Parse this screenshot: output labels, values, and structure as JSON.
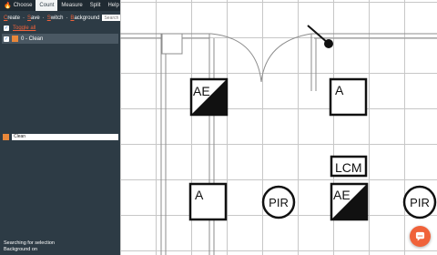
{
  "tabs": [
    {
      "label": "Choose",
      "icon": "flame-icon",
      "active": false
    },
    {
      "label": "Count",
      "active": true
    },
    {
      "label": "Measure",
      "active": false
    },
    {
      "label": "Split",
      "active": false
    },
    {
      "label": "Help",
      "active": false
    }
  ],
  "actions": {
    "create": {
      "prefix": "",
      "hotkey": "C",
      "rest": "reate"
    },
    "save": {
      "prefix": "",
      "hotkey": "S",
      "rest": "ave"
    },
    "switch": {
      "prefix": "",
      "hotkey": "S",
      "rest": "witch"
    },
    "background": {
      "prefix": "",
      "hotkey": "B",
      "rest": "ackground"
    },
    "separator": "·"
  },
  "search": {
    "placeholder": "Search"
  },
  "toggle_all": {
    "label": "Toggle all",
    "checked": true
  },
  "layers": [
    {
      "label": "0 - Clean",
      "checked": true,
      "color": "#e8873a"
    }
  ],
  "edit_layer": {
    "name": "Clean",
    "color": "#e8873a"
  },
  "status": {
    "line1": "Searching for selection",
    "line2": "Background on"
  },
  "symbols": {
    "ae": "AE",
    "a": "A",
    "pir": "PIR",
    "lcm": "LCM"
  },
  "colors": {
    "sidebar": "#2d3b45",
    "accent": "#f0623a",
    "layer_swatch": "#e8873a"
  },
  "fab": {
    "icon": "chat-icon"
  }
}
